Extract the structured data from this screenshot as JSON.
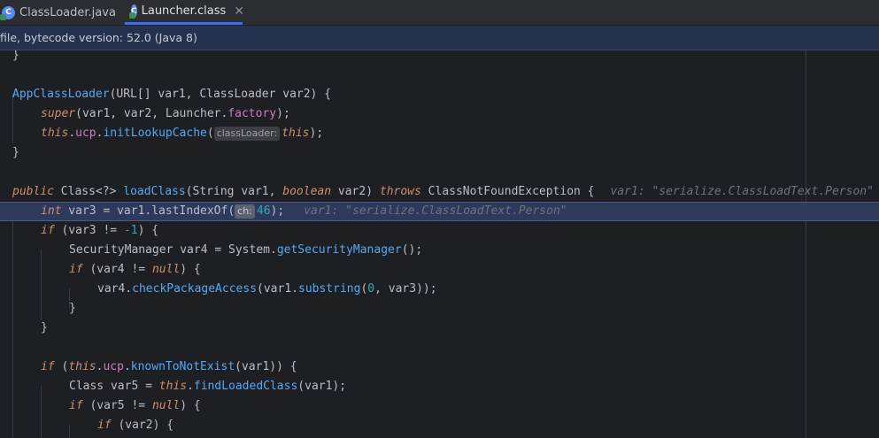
{
  "tabs": [
    {
      "label": "ClassLoader.java",
      "active": false
    },
    {
      "label": "Launcher.class",
      "active": true
    }
  ],
  "banner": "file, bytecode version: 52.0 (Java 8)",
  "colors": {
    "accent": "#3574f0",
    "keyword": "#cf8e6d",
    "method": "#56a8f5",
    "field": "#c77dbb",
    "number": "#2aacb8",
    "hint": "#6f737a",
    "highlight": "#2e3a5c"
  },
  "code": {
    "l1": "}",
    "l3_fn": "AppClassLoader",
    "l3_a": "(URL[] var1, ClassLoader var2) {",
    "l4_super": "super",
    "l4_a": "(var1, var2, Launcher.",
    "l4_field": "factory",
    "l4_b": ");",
    "l5_this": "this",
    "l5_dot": ".",
    "l5_field": "ucp",
    "l5_dot2": ".",
    "l5_fn": "initLookupCache",
    "l5_paren": "(",
    "l5_inlay": "classLoader:",
    "l5_this2": "this",
    "l5_end": ");",
    "l6": "}",
    "l8_kw": "public",
    "l8_a": " Class<?> ",
    "l8_fn": "loadClass",
    "l8_b": "(String var1, ",
    "l8_kw2": "boolean",
    "l8_c": " var2) ",
    "l8_kw3": "throws",
    "l8_d": " ClassNotFoundException {",
    "l8_hint": "var1: \"serialize.ClassLoadText.Person\"",
    "l9_kw": "int",
    "l9_a": " var3 = var1.lastIndexOf(",
    "l9_inlay": "ch:",
    "l9_num": "46",
    "l9_b": ");",
    "l9_hint": "var1: \"serialize.ClassLoadText.Person\"",
    "l10_kw": "if",
    "l10_a": " (var3 != ",
    "l10_num": "-1",
    "l10_b": ") {",
    "l11_a": "SecurityManager var4 = System.",
    "l11_fn": "getSecurityManager",
    "l11_b": "();",
    "l12_kw": "if",
    "l12_a": " (var4 != ",
    "l12_kw2": "null",
    "l12_b": ") {",
    "l13_a": "var4.",
    "l13_fn": "checkPackageAccess",
    "l13_b": "(var1.",
    "l13_fn2": "substring",
    "l13_c": "(",
    "l13_num": "0",
    "l13_d": ", var3));",
    "l14": "}",
    "l15": "}",
    "l17_kw": "if",
    "l17_a": " (",
    "l17_this": "this",
    "l17_dot": ".",
    "l17_field": "ucp",
    "l17_dot2": ".",
    "l17_fn": "knownToNotExist",
    "l17_b": "(var1)) {",
    "l18_a": "Class var5 = ",
    "l18_this": "this",
    "l18_dot": ".",
    "l18_fn": "findLoadedClass",
    "l18_b": "(var1);",
    "l19_kw": "if",
    "l19_a": " (var5 != ",
    "l19_kw2": "null",
    "l19_b": ") {",
    "l20_kw": "if",
    "l20_a": " (var2) {"
  }
}
